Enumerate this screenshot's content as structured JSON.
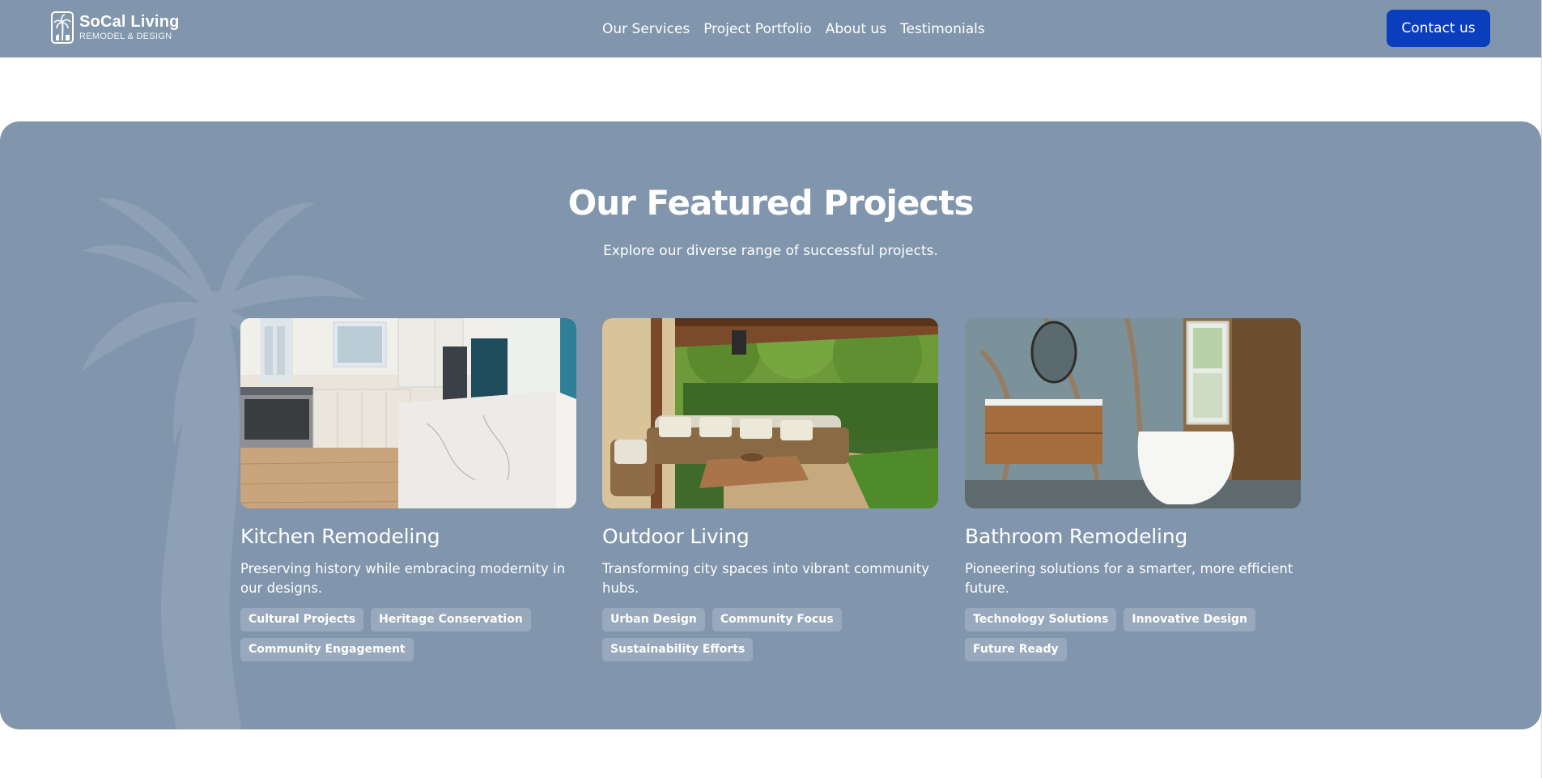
{
  "header": {
    "logo": {
      "name": "SoCal Living",
      "tagline": "REMODEL & DESIGN",
      "icon": "palm-tree-icon"
    },
    "nav": [
      {
        "label": "Our Services"
      },
      {
        "label": "Project Portfolio"
      },
      {
        "label": "About us"
      },
      {
        "label": "Testimonials"
      }
    ],
    "contact_label": "Contact us"
  },
  "featured": {
    "title": "Our Featured Projects",
    "subtitle": "Explore our diverse range of successful projects.",
    "projects": [
      {
        "title": "Kitchen Remodeling",
        "description": "Preserving history while embracing modernity in our designs.",
        "tags": [
          "Cultural Projects",
          "Heritage Conservation",
          "Community Engagement"
        ]
      },
      {
        "title": "Outdoor Living",
        "description": "Transforming city spaces into vibrant community hubs.",
        "tags": [
          "Urban Design",
          "Community Focus",
          "Sustainability Efforts"
        ]
      },
      {
        "title": "Bathroom Remodeling",
        "description": "Pioneering solutions for a smarter, more efficient future.",
        "tags": [
          "Technology Solutions",
          "Innovative Design",
          "Future Ready"
        ]
      }
    ]
  },
  "colors": {
    "header_bg": "#8195ac",
    "section_bg": "#8195ac",
    "contact_button": "#0a3ebd",
    "tag_bg": "#98a9bd",
    "text": "#ffffff"
  }
}
